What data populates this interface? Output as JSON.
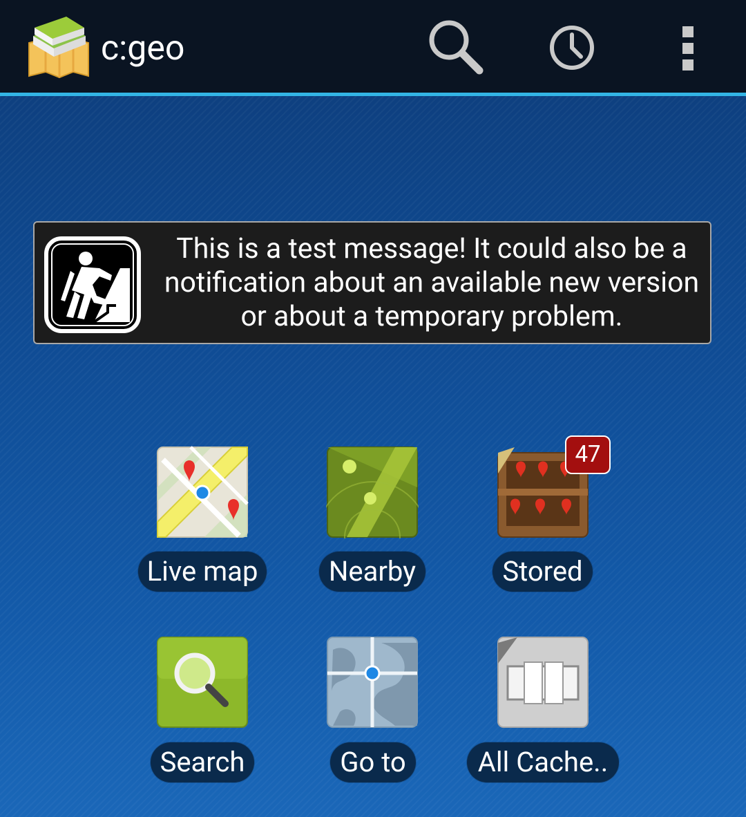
{
  "actionbar": {
    "title": "c:geo",
    "accent_color": "#33b5e5",
    "logo_icon": "cgeo-map-book-icon",
    "actions": [
      {
        "name": "search",
        "icon": "search-icon"
      },
      {
        "name": "history",
        "icon": "clock-icon"
      },
      {
        "name": "overflow",
        "icon": "overflow-menu-icon"
      }
    ]
  },
  "message": {
    "icon": "hiker-icon",
    "text": "This is a test message! It could also be a notification about an available new version or about a temporary problem."
  },
  "tiles": [
    {
      "label": "Live map",
      "icon": "live-map-icon"
    },
    {
      "label": "Nearby",
      "icon": "nearby-radar-icon"
    },
    {
      "label": "Stored",
      "icon": "stored-caches-icon",
      "badge": "47"
    },
    {
      "label": "Search",
      "icon": "search-magnifier-icon"
    },
    {
      "label": "Go to",
      "icon": "go-to-globe-icon"
    },
    {
      "label": "All Cache..",
      "icon": "all-caches-icon"
    }
  ],
  "colors": {
    "badge": "#a30f0f",
    "label_bg": "#0a2a4c",
    "message_bg": "#1c1c1c"
  }
}
